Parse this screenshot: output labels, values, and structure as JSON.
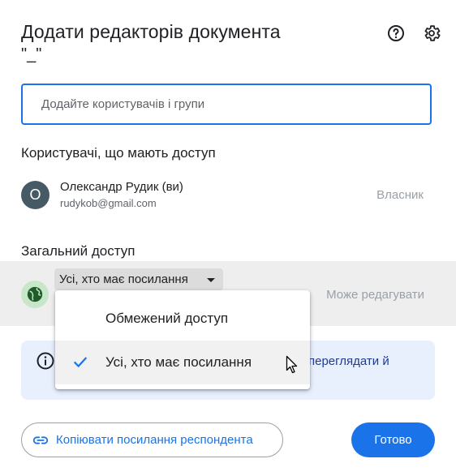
{
  "dialog": {
    "title": "Додати редакторів документа",
    "subtitle": "\"_\"",
    "help_icon": "help-circle-icon",
    "settings_icon": "gear-icon"
  },
  "search": {
    "placeholder": "Додайте користувачів і групи",
    "value": ""
  },
  "people_section": {
    "heading": "Користувачі, що мають доступ",
    "users": [
      {
        "initial": "О",
        "name": "Олександр Рудик (ви)",
        "email": "rudykob@gmail.com",
        "role": "Власник",
        "avatar_color": "#455a64"
      }
    ]
  },
  "general_access": {
    "heading": "Загальний доступ",
    "selected": "Усі, хто має посилання",
    "role": "Може редагувати",
    "info_text_visible": "ь переглядати й",
    "icon": "globe-icon",
    "dropdown_options": [
      {
        "label": "Обмежений доступ",
        "selected": false
      },
      {
        "label": "Усі, хто має посилання",
        "selected": true
      }
    ]
  },
  "footer": {
    "copy_link_label": "Копіювати посилання респондента",
    "done_label": "Готово"
  },
  "colors": {
    "accent": "#1a73e8",
    "info_bg": "#e8f0fe",
    "access_row_bg": "#eeeeee"
  }
}
